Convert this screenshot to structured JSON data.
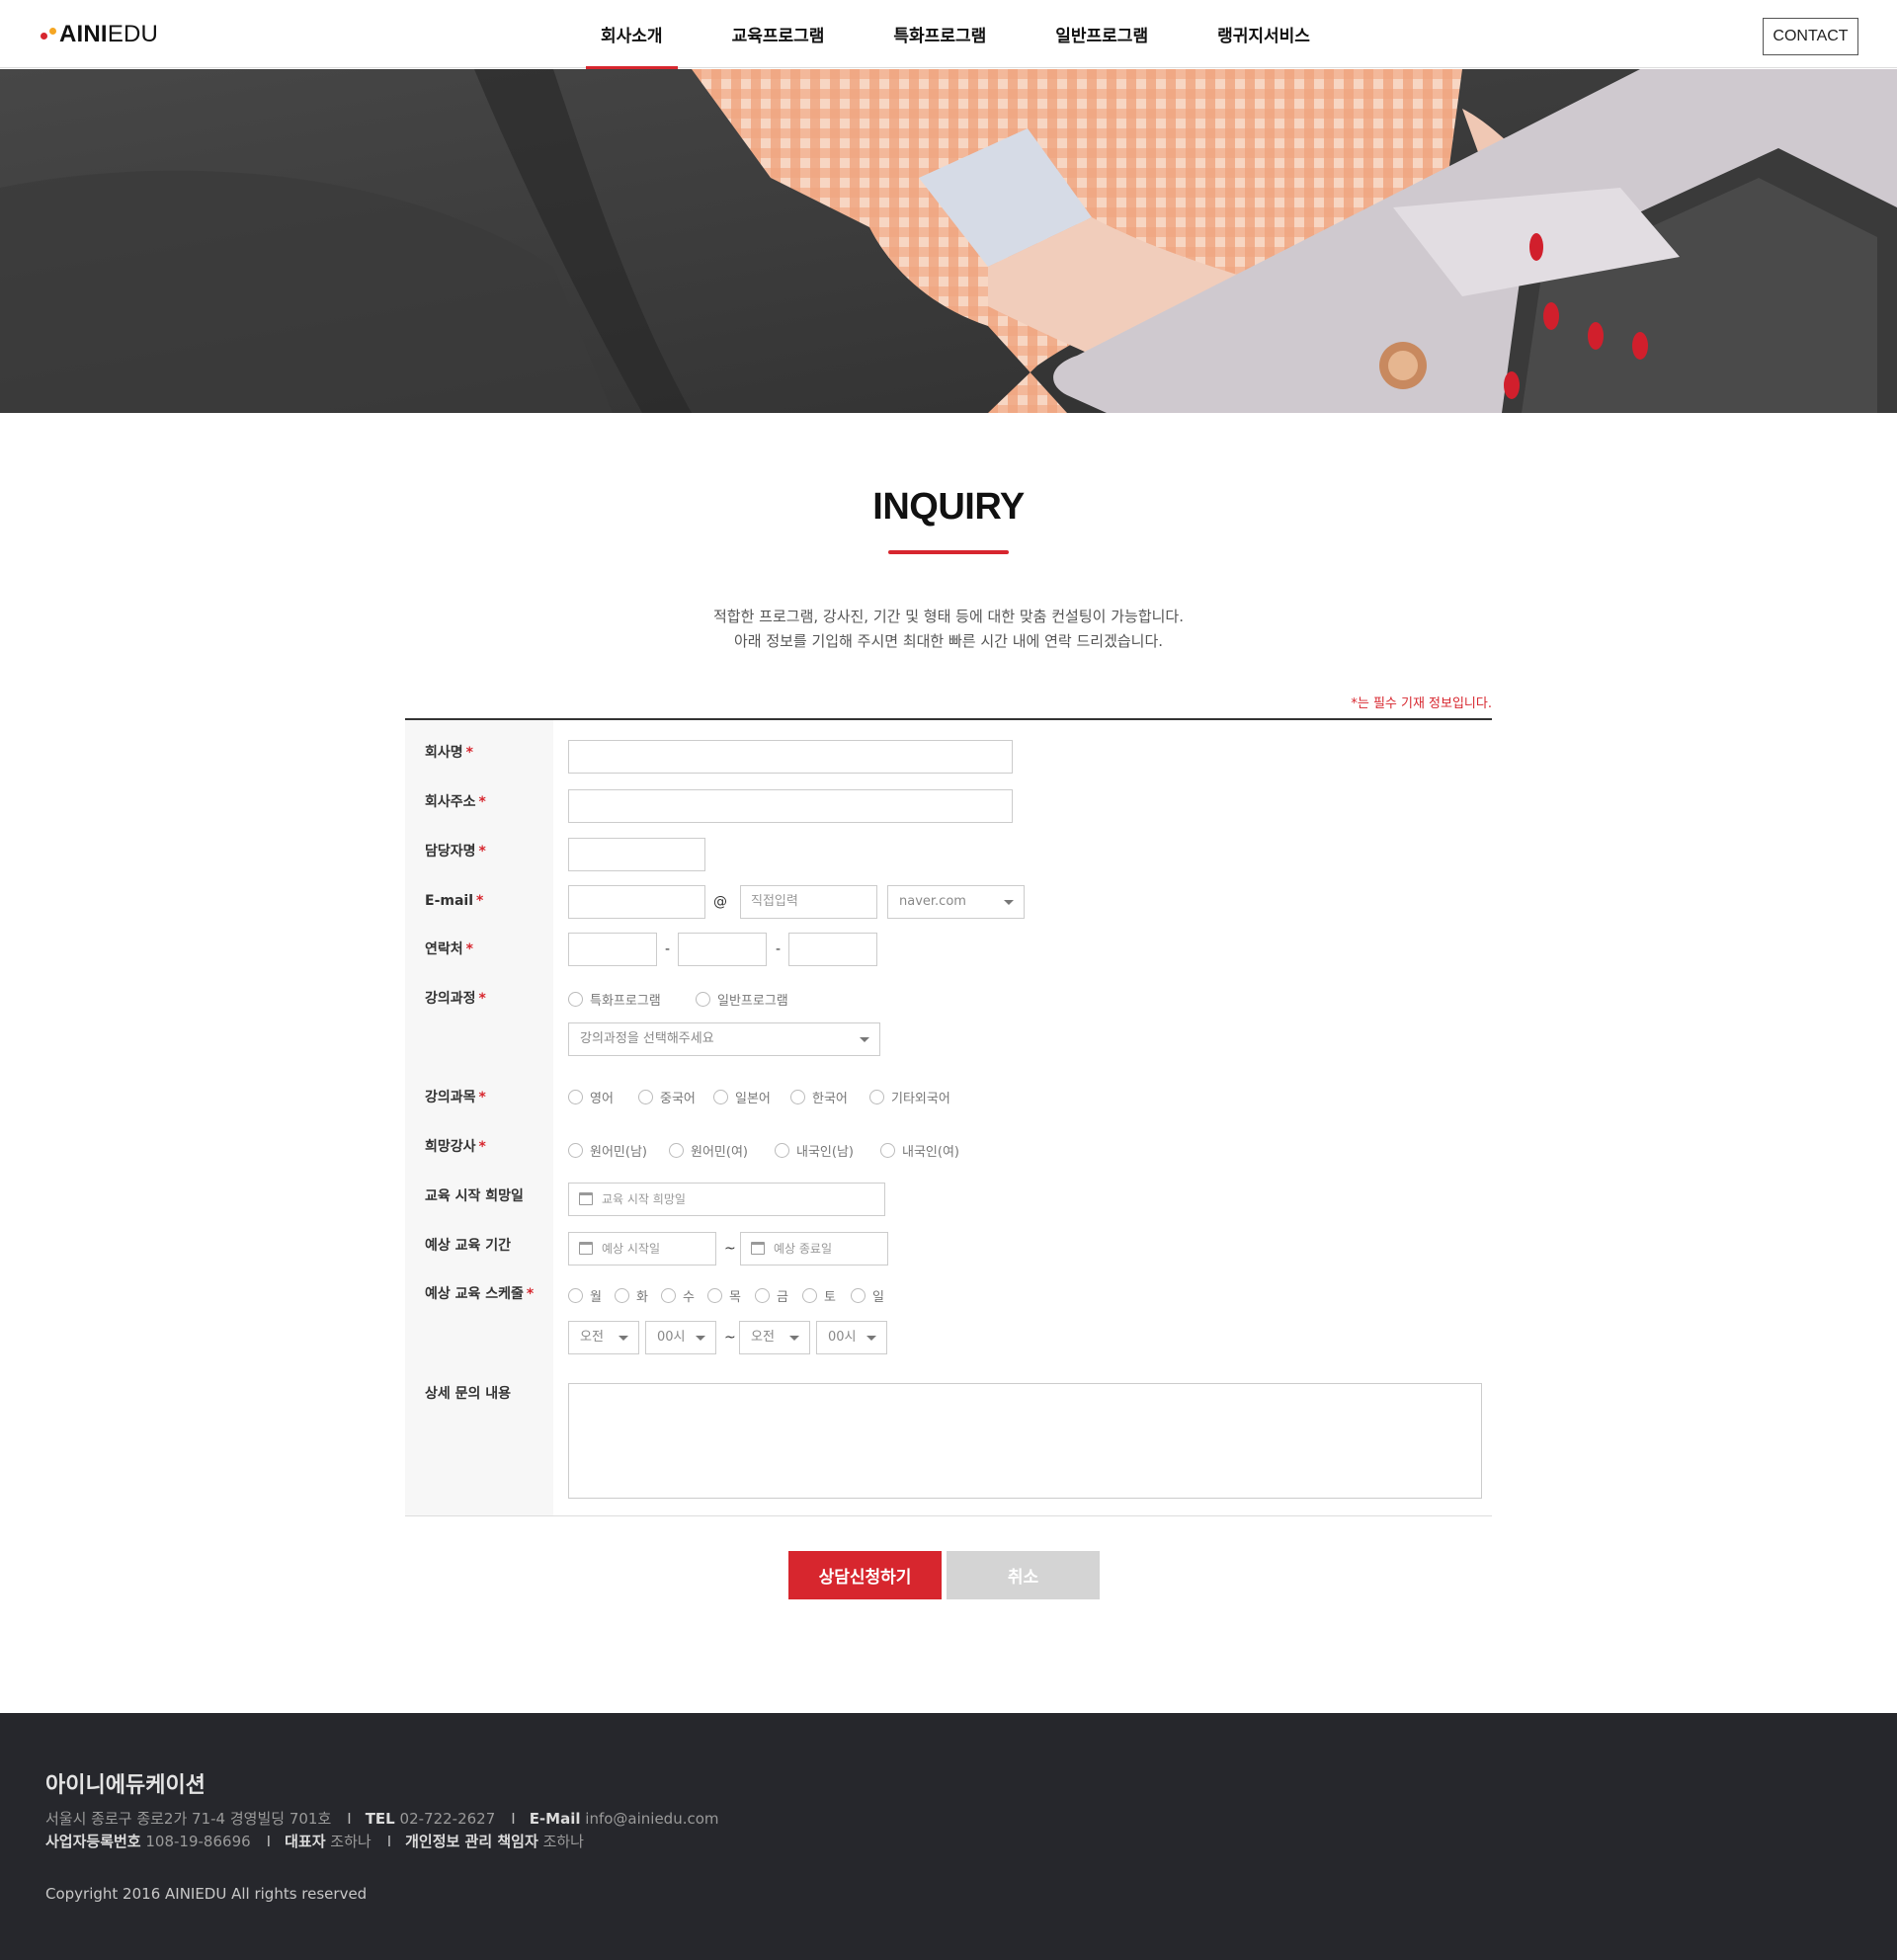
{
  "header": {
    "logo_bold": "AINI",
    "logo_light": "EDU",
    "nav": [
      {
        "label": "회사소개",
        "active": true
      },
      {
        "label": "교육프로그램",
        "active": false
      },
      {
        "label": "특화프로그램",
        "active": false
      },
      {
        "label": "일반프로그램",
        "active": false
      },
      {
        "label": "랭귀지서비스",
        "active": false
      }
    ],
    "contact_label": "CONTACT"
  },
  "page": {
    "title": "INQUIRY",
    "intro_line1": "적합한 프로그램, 강사진, 기간 및 형태 등에 대한 맞춤 컨설팅이 가능합니다.",
    "intro_line2": "아래 정보를 기입해 주시면 최대한 빠른 시간 내에 연락 드리겠습니다.",
    "required_note_star": "*",
    "required_note": "는 필수 기재 정보입니다."
  },
  "form": {
    "required_mark": "*",
    "company_label": "회사명",
    "address_label": "회사주소",
    "manager_label": "담당자명",
    "email_label": "E-mail",
    "email_at": "@",
    "email_domain_placeholder": "직접입력",
    "email_domain_select": "naver.com",
    "phone_label": "연락처",
    "phone_sep": "-",
    "course_label": "강의과정",
    "course_options": [
      "특화프로그램",
      "일반프로그램"
    ],
    "course_select": "강의과정을 선택해주세요",
    "subject_label": "강의과목",
    "subject_options": [
      "영어",
      "중국어",
      "일본어",
      "한국어",
      "기타외국어"
    ],
    "instructor_label": "희망강사",
    "instructor_options": [
      "원어민(남)",
      "원어민(여)",
      "내국인(남)",
      "내국인(여)"
    ],
    "start_label": "교육 시작 희망일",
    "start_placeholder": "교육 시작 희망일",
    "period_label": "예상 교육 기간",
    "period_start_placeholder": "예상 시작일",
    "period_end_placeholder": "예상 종료일",
    "range_sep": "~",
    "schedule_label": "예상 교육 스케줄",
    "days": [
      "월",
      "화",
      "수",
      "목",
      "금",
      "토",
      "일"
    ],
    "ampm_from": "오전",
    "hour_from": "00시",
    "ampm_to": "오전",
    "hour_to": "00시",
    "detail_label": "상세 문의 내용"
  },
  "buttons": {
    "submit": "상담신청하기",
    "cancel": "취소"
  },
  "footer": {
    "company": "아이니에듀케이션",
    "address": "서울시 종로구 종로2가 71-4 경영빌딩 701호",
    "tel_label": "TEL",
    "tel": "02-722-2627",
    "email_label": "E-Mail",
    "email": "info@ainiedu.com",
    "bizno_label": "사업자등록번호",
    "bizno": "108-19-86696",
    "ceo_label": "대표자",
    "ceo": "조하나",
    "privacy_label": "개인정보 관리 책임자",
    "privacy": "조하나",
    "copyright": "Copyright 2016 AINIEDU All rights reserved"
  },
  "colors": {
    "accent": "#d7262e",
    "footer_bg": "#26272c",
    "cancel_bg": "#d4d4d4"
  },
  "icons": [
    "calendar-icon",
    "chevron-down-icon"
  ]
}
